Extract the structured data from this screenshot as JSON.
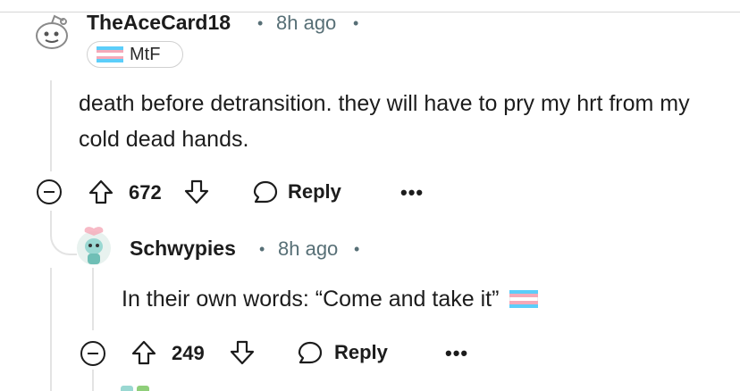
{
  "comments": [
    {
      "username": "TheAceCard18",
      "separator": "•",
      "time": "8h ago",
      "trailing_dot": "•",
      "flair": "MtF",
      "body": "death before detransition. they will have to pry my hrt from my cold dead hands.",
      "score": "672",
      "reply_label": "Reply",
      "more_label": "•••"
    },
    {
      "username": "Schwypies",
      "separator": "•",
      "time": "8h ago",
      "trailing_dot": "•",
      "body": "In their own words: “Come and take it”",
      "score": "249",
      "reply_label": "Reply",
      "more_label": "•••"
    }
  ],
  "colors": {
    "trans_blue": "#5BCEFA",
    "trans_pink": "#F5A9B8",
    "thread_line": "#e3e3e3",
    "meta_text": "#576f76"
  },
  "icons": [
    "collapse-icon",
    "upvote-icon",
    "downvote-icon",
    "reply-bubble-icon",
    "more-options-icon",
    "trans-flag-icon"
  ]
}
